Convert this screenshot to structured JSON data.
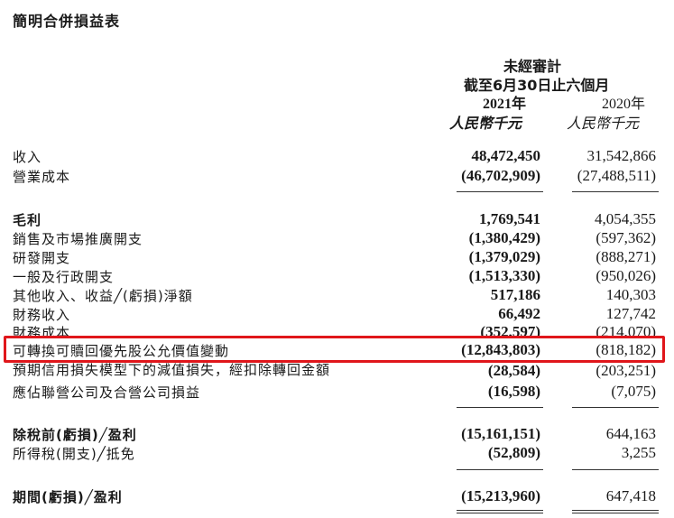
{
  "title": "簡明合併損益表",
  "header": {
    "audit": "未經審計",
    "period": "截至6月30日止六個月",
    "year_2021": "2021年",
    "year_2020": "2020年",
    "unit_2021": "人民幣千元",
    "unit_2020": "人民幣千元"
  },
  "rows": [
    {
      "label": "收入",
      "v2021": "48,472,450",
      "v2020": "31,542,866",
      "bold": false
    },
    {
      "label": "營業成本",
      "v2021": "(46,702,909)",
      "v2020": "(27,488,511)",
      "bold": false
    },
    {
      "label": "毛利",
      "v2021": "1,769,541",
      "v2020": "4,054,355",
      "bold": true
    },
    {
      "label": "銷售及市場推廣開支",
      "v2021": "(1,380,429)",
      "v2020": "(597,362)",
      "bold": false
    },
    {
      "label": "研發開支",
      "v2021": "(1,379,029)",
      "v2020": "(888,271)",
      "bold": false
    },
    {
      "label": "一般及行政開支",
      "v2021": "(1,513,330)",
      "v2020": "(950,026)",
      "bold": false
    },
    {
      "label": "其他收入、收益╱(虧損)淨額",
      "v2021": "517,186",
      "v2020": "140,303",
      "bold": false
    },
    {
      "label": "財務收入",
      "v2021": "66,492",
      "v2020": "127,742",
      "bold": false
    },
    {
      "label": "財務成本",
      "v2021": "(352,597)",
      "v2020": "(214,070)",
      "bold": false
    },
    {
      "label": "可轉換可贖回優先股公允價值變動",
      "v2021": "(12,843,803)",
      "v2020": "(818,182)",
      "bold": false
    },
    {
      "label": "預期信用損失模型下的減值損失，經扣除轉回金額",
      "v2021": "(28,584)",
      "v2020": "(203,251)",
      "bold": false
    },
    {
      "label": "應佔聯營公司及合營公司損益",
      "v2021": "(16,598)",
      "v2020": "(7,075)",
      "bold": false
    },
    {
      "label": "除稅前(虧損)╱盈利",
      "v2021": "(15,161,151)",
      "v2020": "644,163",
      "bold": true
    },
    {
      "label": "所得稅(開支)╱抵免",
      "v2021": "(52,809)",
      "v2020": "3,255",
      "bold": false
    },
    {
      "label": "期間(虧損)╱盈利",
      "v2021": "(15,213,960)",
      "v2020": "647,418",
      "bold": true
    }
  ],
  "highlight_color": "#e0161b"
}
